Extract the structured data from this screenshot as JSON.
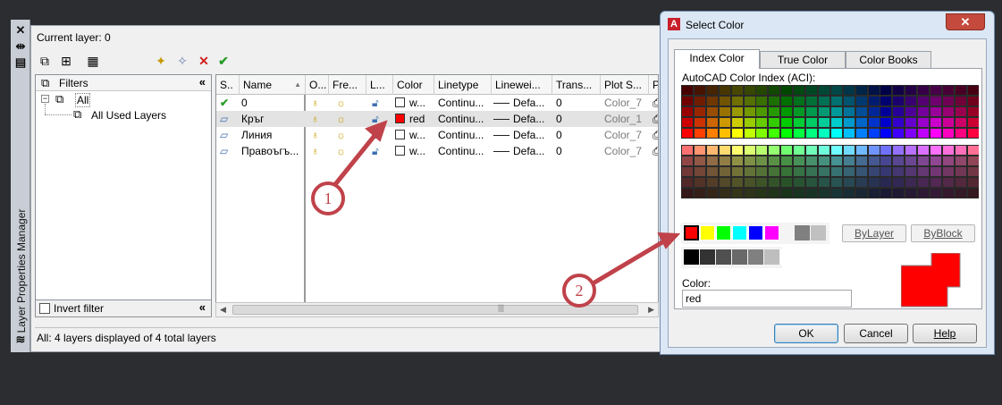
{
  "palette_title": "Layer Properties Manager",
  "current_layer": "Current layer: 0",
  "filters": {
    "header": "Filters",
    "tree": [
      "All",
      "All Used Layers"
    ],
    "invert_label": "Invert filter"
  },
  "columns": [
    "S..",
    "Name",
    "O...",
    "Fre...",
    "L...",
    "Color",
    "Linetype",
    "Linewei...",
    "Trans...",
    "Plot S...",
    "P"
  ],
  "layers": [
    {
      "status": "current",
      "name": "0",
      "color_name": "w...",
      "color_hex": "#ffffff",
      "linetype": "Continu...",
      "lineweight": "Defa...",
      "transparency": "0",
      "plot_style": "Color_7"
    },
    {
      "status": "layer",
      "name": "Кръг",
      "color_name": "red",
      "color_hex": "#ff0000",
      "linetype": "Continu...",
      "lineweight": "Defa...",
      "transparency": "0",
      "plot_style": "Color_1"
    },
    {
      "status": "layer",
      "name": "Линия",
      "color_name": "w...",
      "color_hex": "#ffffff",
      "linetype": "Continu...",
      "lineweight": "Defa...",
      "transparency": "0",
      "plot_style": "Color_7"
    },
    {
      "status": "layer",
      "name": "Правоъгъ...",
      "color_name": "w...",
      "color_hex": "#ffffff",
      "linetype": "Continu...",
      "lineweight": "Defa...",
      "transparency": "0",
      "plot_style": "Color_7"
    }
  ],
  "status_text": "All: 4 layers displayed of 4 total layers",
  "dialog": {
    "title": "Select Color",
    "tabs": [
      "Index Color",
      "True Color",
      "Color Books"
    ],
    "aci_label": "AutoCAD Color Index (ACI):",
    "standard_colors": [
      "#ff0000",
      "#ffff00",
      "#00ff00",
      "#00ffff",
      "#0000ff",
      "#ff00ff"
    ],
    "greys_top": [
      "#808080",
      "#c0c0c0"
    ],
    "greys_bottom": [
      "#000000",
      "#333333",
      "#505050",
      "#696969",
      "#808080",
      "#bebebe",
      "#ffffff"
    ],
    "bylayer_label": "ByLayer",
    "byblock_label": "ByBlock",
    "color_label": "Color:",
    "color_value": "red",
    "preview_color": "#ff0000",
    "ok_label": "OK",
    "cancel_label": "Cancel",
    "help_label": "Help"
  },
  "callouts": [
    "1",
    "2"
  ],
  "accent_color": "#c0424a"
}
